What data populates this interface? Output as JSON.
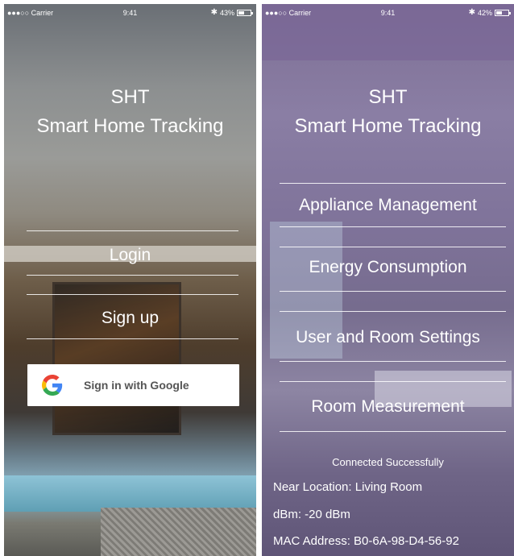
{
  "left_screen": {
    "status": {
      "carrier": "●●●○○ Carrier",
      "time": "9:41",
      "bluetooth": "✱",
      "battery_text": "43%",
      "battery_level": 0.43
    },
    "title_line1": "SHT",
    "title_line2": "Smart Home Tracking",
    "login_label": "Login",
    "signup_label": "Sign up",
    "google_label": "Sign in with Google",
    "google_icon": "google-g-icon"
  },
  "right_screen": {
    "status": {
      "carrier": "●●●○○ Carrier",
      "time": "9:41",
      "bluetooth": "✱",
      "battery_text": "42%",
      "battery_level": 0.42
    },
    "title_line1": "SHT",
    "title_line2": "Smart Home Tracking",
    "menu": [
      {
        "label": "Appliance Management"
      },
      {
        "label": "Energy Consumption"
      },
      {
        "label": "User and Room Settings"
      },
      {
        "label": "Room Measurement"
      }
    ],
    "connection_status": "Connected Successfully",
    "near_location": "Near Location: Living Room",
    "dbm": "dBm: -20 dBm",
    "mac": "MAC Address: B0-6A-98-D4-56-92"
  },
  "colors": {
    "google_blue": "#4285F4",
    "google_red": "#EA4335",
    "google_yellow": "#FBBC05",
    "google_green": "#34A853",
    "overlay_purple": "#7e6f95"
  }
}
